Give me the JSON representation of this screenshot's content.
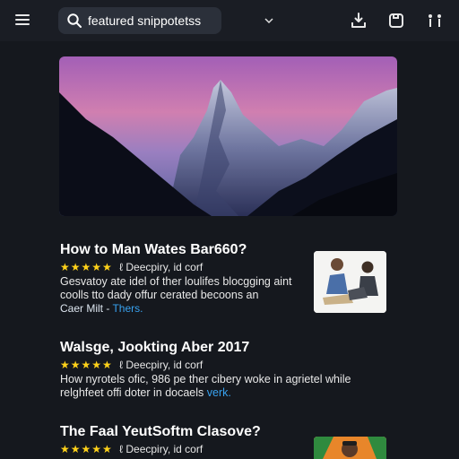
{
  "topbar": {
    "menu_icon": "hamburger-menu-icon",
    "search": {
      "value": "featured snippotetss",
      "icon": "search-icon",
      "dropdown_icon": "chevron-down-icon"
    },
    "actions": [
      "download-icon",
      "save-icon",
      "share-icon"
    ]
  },
  "hero": {
    "description_icon": "mountain-landscape-image"
  },
  "results": [
    {
      "title": "How to Man Wates Bar660?",
      "stars": "★★★★★",
      "source": "ℓ Deecpiry, id corf",
      "desc_line1": "Gesvatoy ate idel of ther loulifes blocgging aint",
      "desc_line2": "coolls tto dady offur cerated becoons an",
      "meta_a": "Caer Milt",
      "meta_sep": " - ",
      "meta_b": "Thers."
    },
    {
      "title": "Walsge, Jookting Aber 2017",
      "stars": "★★★★★",
      "source": "ℓ Deecpiry, id corf",
      "desc_line1": "How nyrotels ofic, 986 pe ther cibery woke in agrietel while",
      "desc_line2": "relghfeet offi doter in docaels",
      "desc_link": "verk."
    },
    {
      "title": "The Faal YeutSoftm Clasove?",
      "stars": "★★★★★",
      "source": "ℓ Deecpiry, id corf"
    }
  ],
  "colors": {
    "background": "#15181e",
    "star": "#ffd21a",
    "link": "#38a2f0"
  }
}
